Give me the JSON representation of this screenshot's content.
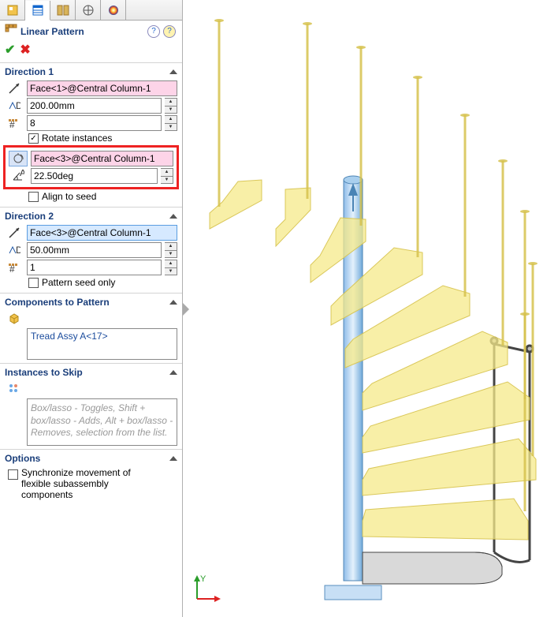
{
  "header": {
    "featureTitle": "Linear Pattern",
    "help1Hint": "?",
    "help2Hint": "?"
  },
  "direction1": {
    "title": "Direction 1",
    "edge": "Face<1>@Central Column-1",
    "spacing": "200.00mm",
    "count": "8",
    "rotateInstances": "Rotate instances",
    "rotateAxis": "Face<3>@Central Column-1",
    "angle": "22.50deg",
    "alignToSeed": "Align to seed"
  },
  "direction2": {
    "title": "Direction 2",
    "edge": "Face<3>@Central Column-1",
    "spacing": "50.00mm",
    "count": "1",
    "patternSeedOnly": "Pattern seed only"
  },
  "componentsToPattern": {
    "title": "Components to Pattern",
    "item0": "Tread Assy A<17>"
  },
  "instancesToSkip": {
    "title": "Instances to Skip",
    "hint": "Box/lasso - Toggles, Shift + box/lasso - Adds, Alt + box/lasso - Removes, selection from the list."
  },
  "options": {
    "title": "Options",
    "syncFlexible": "Synchronize movement of flexible subassembly components"
  }
}
